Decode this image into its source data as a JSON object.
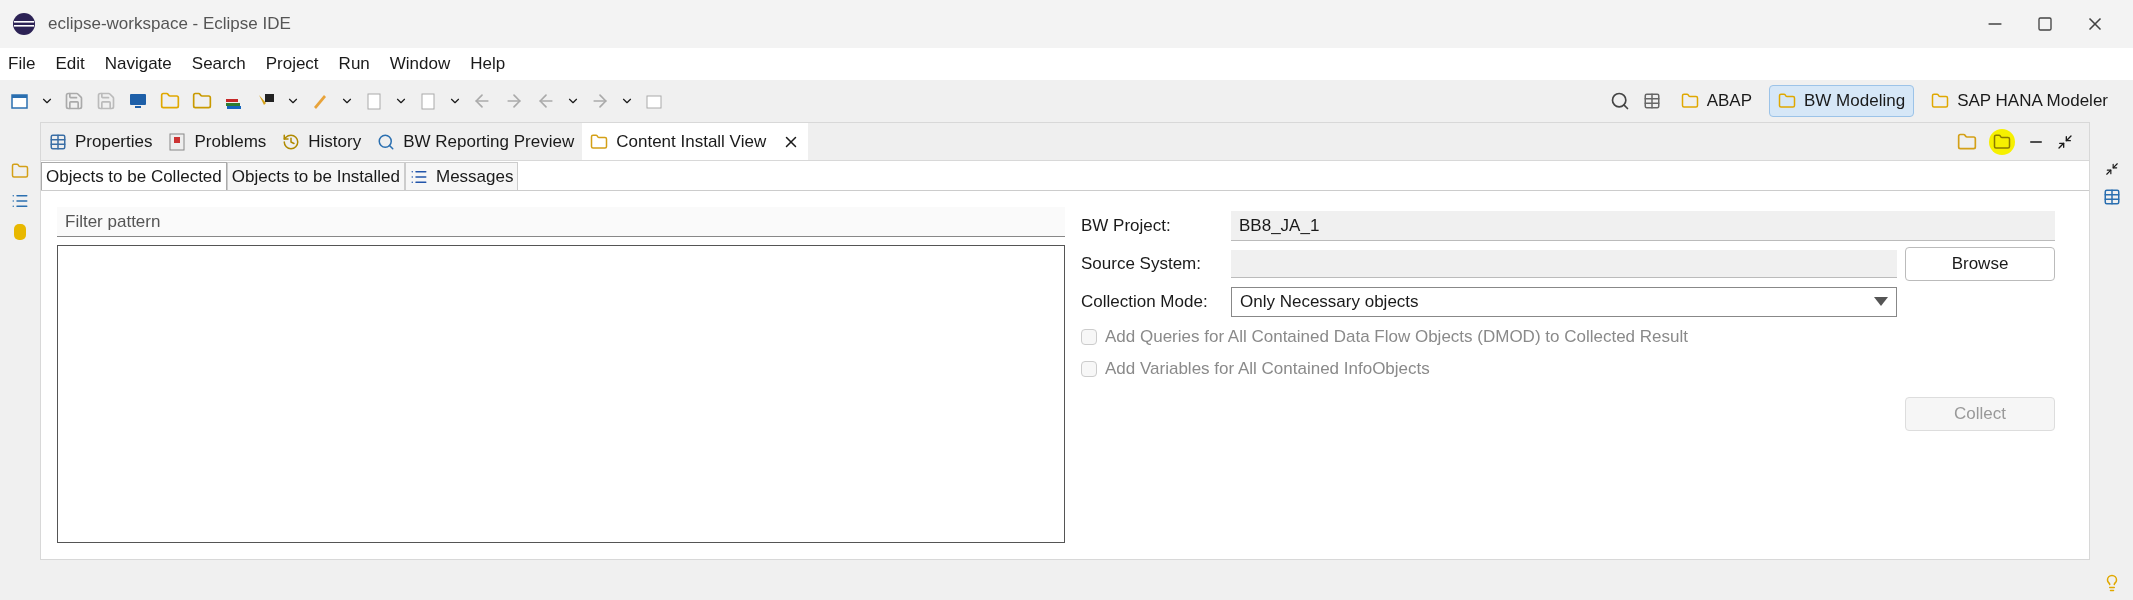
{
  "window": {
    "title": "eclipse-workspace - Eclipse IDE"
  },
  "menu": [
    "File",
    "Edit",
    "Navigate",
    "Search",
    "Project",
    "Run",
    "Window",
    "Help"
  ],
  "perspectives": [
    {
      "label": "ABAP",
      "selected": false
    },
    {
      "label": "BW Modeling",
      "selected": true
    },
    {
      "label": "SAP HANA Modeler",
      "selected": false
    }
  ],
  "view_tabs": [
    {
      "label": "Properties",
      "selected": false
    },
    {
      "label": "Problems",
      "selected": false
    },
    {
      "label": "History",
      "selected": false
    },
    {
      "label": "BW Reporting Preview",
      "selected": false
    },
    {
      "label": "Content Install View",
      "selected": true
    }
  ],
  "sub_tabs": [
    {
      "label": "Objects to be Collected",
      "selected": true
    },
    {
      "label": "Objects to be Installed",
      "selected": false
    },
    {
      "label": "Messages",
      "selected": false
    }
  ],
  "filter": {
    "placeholder": "Filter pattern"
  },
  "bw_project": {
    "label": "BW Project:",
    "value": "BB8_JA_1"
  },
  "source_system": {
    "label": "Source System:",
    "button": "Browse"
  },
  "collection_mode": {
    "label": "Collection Mode:",
    "value": "Only Necessary objects"
  },
  "options": [
    {
      "label": "Add Queries for All Contained Data Flow Objects (DMOD) to Collected Result",
      "checked": false,
      "disabled": true
    },
    {
      "label": "Add Variables for All Contained InfoObjects",
      "checked": false,
      "disabled": true
    }
  ],
  "collect_button": {
    "label": "Collect",
    "disabled": true
  }
}
